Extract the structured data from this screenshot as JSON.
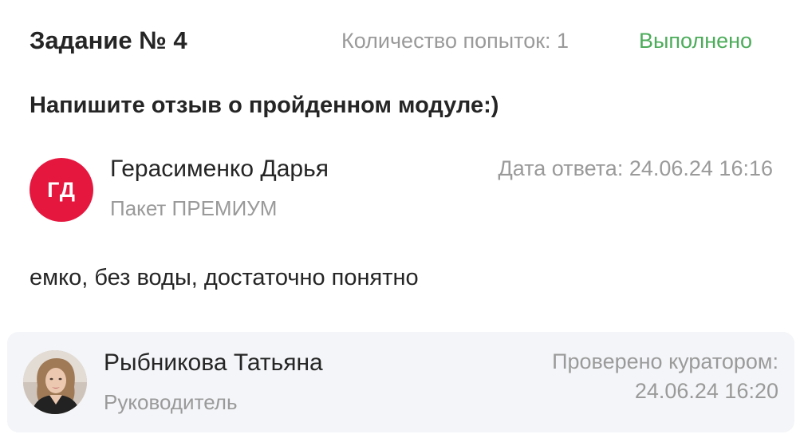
{
  "task": {
    "title": "Задание № 4",
    "attempts": "Количество попыток: 1",
    "status": "Выполнено",
    "status_color": "#4cac5a",
    "question": "Напишите отзыв о пройденном модуле:)"
  },
  "answer": {
    "author_initials": "ГД",
    "avatar_color": "#e5173f",
    "author_name": "Герасименко Дарья",
    "author_package": "Пакет ПРЕМИУМ",
    "date": "Дата ответа: 24.06.24 16:16",
    "text": "емко, без воды, достаточно понятно"
  },
  "review": {
    "reviewer_name": "Рыбникова Татьяна",
    "reviewer_role": "Руководитель",
    "checked_label": "Проверено куратором:",
    "checked_date": "24.06.24 16:20",
    "avatar_icon": "user-photo-icon"
  }
}
